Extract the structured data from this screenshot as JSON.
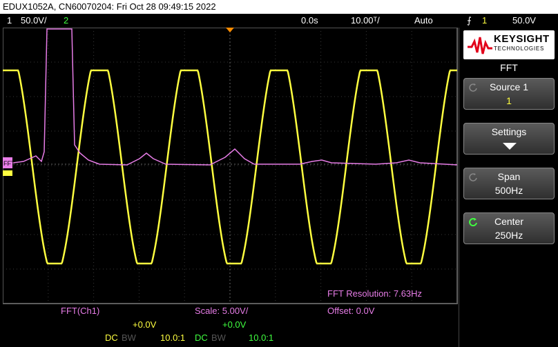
{
  "title_bar": "EDUX1052A, CN60070204: Fri Oct 28 09:49:15 2022",
  "top_bar": {
    "ch1_label": "1",
    "ch1_scale": "50.0V/",
    "ch2_label": "2",
    "time_delay": "0.0s",
    "time_scale": "10.00ᵀ/",
    "trigger_mode": "Auto",
    "trigger_slope_icon": "rising-edge-icon",
    "trigger_source": "1",
    "trigger_level": "50.0V"
  },
  "side_panel": {
    "brand": "KEYSIGHT",
    "brand_sub": "TECHNOLOGIES",
    "menu_title": "FFT",
    "softkeys": [
      {
        "label": "Source 1",
        "value": "1"
      },
      {
        "label": "Settings",
        "value": ""
      },
      {
        "label": "Span",
        "value": "500Hz"
      },
      {
        "label": "Center",
        "value": "250Hz"
      }
    ]
  },
  "screen": {
    "fft_resolution": "FFT Resolution: 7.63Hz",
    "marker_ch_label": "FFT"
  },
  "bottom_bar": {
    "fft_source": "FFT(Ch1)",
    "scale": "Scale: 5.00V/",
    "offset": "Offset: 0.0V"
  },
  "channel_bar": {
    "ch1_offset": "+0.0V",
    "ch1_coupling": "DC",
    "ch1_bw": "BW",
    "ch1_probe": "10.0:1",
    "ch2_offset": "+0.0V",
    "ch2_coupling": "DC",
    "ch2_bw": "BW",
    "ch2_probe": "10.0:1"
  },
  "colors": {
    "ch1": "#ffff40",
    "ch2": "#40ff40",
    "fft": "#e87de8",
    "trigger_marker": "#ff8c00"
  }
}
